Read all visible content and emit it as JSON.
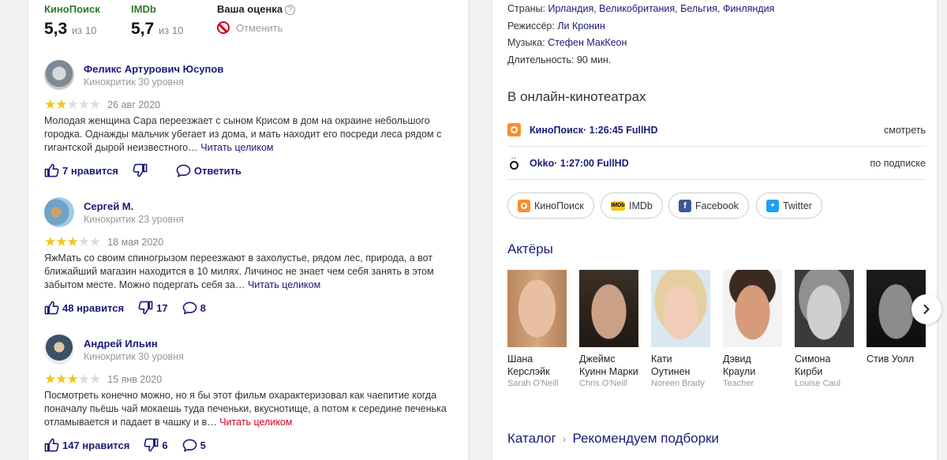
{
  "ratings": {
    "kp": {
      "source": "КиноПоиск",
      "value": "5,3",
      "of": "из 10"
    },
    "imdb": {
      "source": "IMDb",
      "value": "5,7",
      "of": "из 10"
    },
    "user": {
      "label": "Ваша оценка",
      "help": "?",
      "cancel": "Отменить"
    }
  },
  "reviews": [
    {
      "name": "Феликс Артурович Юсупов",
      "rank": "Кинокритик 30 уровня",
      "stars": 2,
      "date": "26 авг 2020",
      "text": "Молодая женщина Сара переезжает с сыном Крисом в дом на окраине небольшого городка. Однажды мальчик убегает из дома, и мать находит его посреди леса рядом с гигантской дырой неизвестного…",
      "more": "Читать целиком",
      "likes": "7 нравится",
      "dislikes": "",
      "reply": "Ответить",
      "comments": ""
    },
    {
      "name": "Сергей М.",
      "rank": "Кинокритик 23 уровня",
      "stars": 3,
      "date": "18 мая 2020",
      "text": "ЯжМать со своим спиногрызом переезжают в захолустье, рядом лес, природа, а вот ближайший магазин находится в 10 милях. Личинос не знает чем себя занять в этом забытом месте. Можно подергать себя за…",
      "more": "Читать целиком",
      "likes": "48 нравится",
      "dislikes": "17",
      "comments": "8"
    },
    {
      "name": "Андрей Ильин",
      "rank": "Кинокритик 30 уровня",
      "stars": 3,
      "date": "15 янв 2020",
      "text": "Посмотреть конечно можно, но я бы этот фильм охарактеризовал как чаепитие когда поначалу пьёшь чай мокаешь туда печеньки, вкуснотище, а потом к середине печенька отламывается и падает в чашку и в…",
      "more": "Читать целиком",
      "likes": "147 нравится",
      "dislikes": "6",
      "comments": "5"
    }
  ],
  "meta": {
    "countries_label": "Страны:",
    "countries": [
      "Ирландия",
      "Великобритания",
      "Бельгия",
      "Финляндия"
    ],
    "director_label": "Режиссёр:",
    "director": "Ли Кронин",
    "music_label": "Музыка:",
    "music": "Стефен МакКеон",
    "duration_label": "Длительность:",
    "duration": "90 мин."
  },
  "online": {
    "title": "В онлайн-кинотеатрах",
    "items": [
      {
        "name": "КиноПоиск",
        "meta": " · 1:26:45 FullHD",
        "action": "смотреть"
      },
      {
        "name": "Okko",
        "meta": " · 1:27:00 FullHD",
        "action": "по подписке"
      }
    ]
  },
  "external": [
    {
      "label": "КиноПоиск",
      "icon": "kinopoisk-icon",
      "color": "#ff6600"
    },
    {
      "label": "IMDb",
      "icon": "imdb-icon",
      "color": "#f5c518"
    },
    {
      "label": "Facebook",
      "icon": "facebook-icon",
      "color": "#3b5998"
    },
    {
      "label": "Twitter",
      "icon": "twitter-icon",
      "color": "#1da1f2"
    }
  ],
  "actors": {
    "title": "Актёры",
    "items": [
      {
        "name": "Шана Керслэйк",
        "role": "Sarah O'Neill"
      },
      {
        "name": "Джеймс Куинн Марки",
        "role": "Chris O'Neill"
      },
      {
        "name": "Кати Оутинен",
        "role": "Noreen Brady"
      },
      {
        "name": "Дэвид Краули",
        "role": "Teacher"
      },
      {
        "name": "Симона Кирби",
        "role": "Louise Caul"
      },
      {
        "name": "Стив Уолл",
        "role": ""
      }
    ]
  },
  "bottom": {
    "catalog": "Каталог",
    "sep": "›",
    "recommend": "Рекомендуем подборки"
  }
}
